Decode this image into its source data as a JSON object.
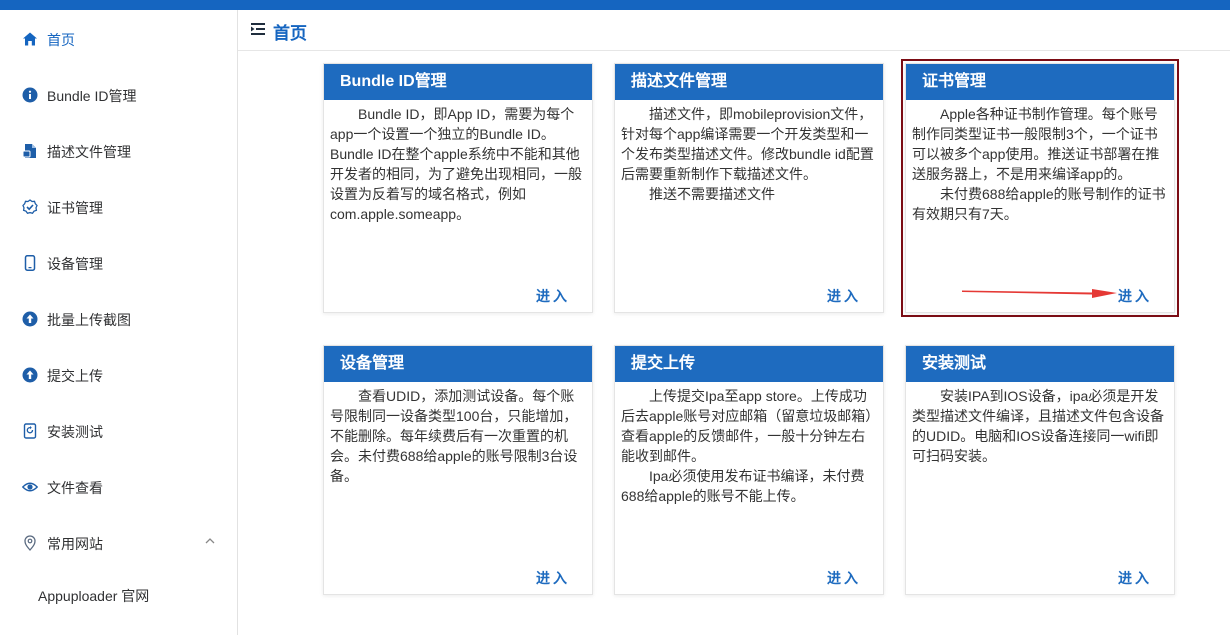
{
  "header": {
    "title": "首页",
    "menu_icon": "menu-fold-icon"
  },
  "colors": {
    "primary": "#1565c0",
    "card_header": "#1e6bbf",
    "highlight_border": "#7b0c14",
    "arrow": "#e53935"
  },
  "sidebar": {
    "items": [
      {
        "label": "首页",
        "icon": "home-icon",
        "active": true
      },
      {
        "label": "Bundle ID管理",
        "icon": "info-icon"
      },
      {
        "label": "描述文件管理",
        "icon": "file-icon"
      },
      {
        "label": "证书管理",
        "icon": "certificate-icon"
      },
      {
        "label": "设备管理",
        "icon": "phone-icon"
      },
      {
        "label": "批量上传截图",
        "icon": "upload-icon"
      },
      {
        "label": "提交上传",
        "icon": "upload-icon"
      },
      {
        "label": "安装测试",
        "icon": "install-icon"
      },
      {
        "label": "文件查看",
        "icon": "eye-icon"
      },
      {
        "label": "常用网站",
        "icon": "location-icon",
        "expanded": true
      }
    ],
    "sub_items": [
      {
        "label": "Appuploader 官网"
      }
    ]
  },
  "cards": [
    {
      "title": "Bundle ID管理",
      "paragraphs": [
        "Bundle ID，即App ID，需要为每个app一个设置一个独立的Bundle ID。Bundle ID在整个apple系统中不能和其他开发者的相同，为了避免出现相同，一般设置为反着写的域名格式，例如com.apple.someapp。"
      ],
      "enter": "进入"
    },
    {
      "title": "描述文件管理",
      "paragraphs": [
        "描述文件，即mobileprovision文件，针对每个app编译需要一个开发类型和一个发布类型描述文件。修改bundle id配置后需要重新制作下载描述文件。",
        "推送不需要描述文件"
      ],
      "enter": "进入"
    },
    {
      "title": "证书管理",
      "paragraphs": [
        "Apple各种证书制作管理。每个账号制作同类型证书一般限制3个，一个证书可以被多个app使用。推送证书部署在推送服务器上，不是用来编译app的。",
        "未付费688给apple的账号制作的证书有效期只有7天。"
      ],
      "enter": "进入"
    },
    {
      "title": "设备管理",
      "paragraphs": [
        "查看UDID，添加测试设备。每个账号限制同一设备类型100台，只能增加，不能删除。每年续费后有一次重置的机会。未付费688给apple的账号限制3台设备。"
      ],
      "enter": "进入"
    },
    {
      "title": "提交上传",
      "paragraphs": [
        "上传提交Ipa至app store。上传成功后去apple账号对应邮箱（留意垃圾邮箱）查看apple的反馈邮件，一般十分钟左右能收到邮件。",
        "Ipa必须使用发布证书编译，未付费688给apple的账号不能上传。"
      ],
      "enter": "进入"
    },
    {
      "title": "安装测试",
      "paragraphs": [
        "安装IPA到IOS设备，ipa必须是开发类型描述文件编译，且描述文件包含设备的UDID。电脑和IOS设备连接同一wifi即可扫码安装。"
      ],
      "enter": "进入"
    }
  ]
}
